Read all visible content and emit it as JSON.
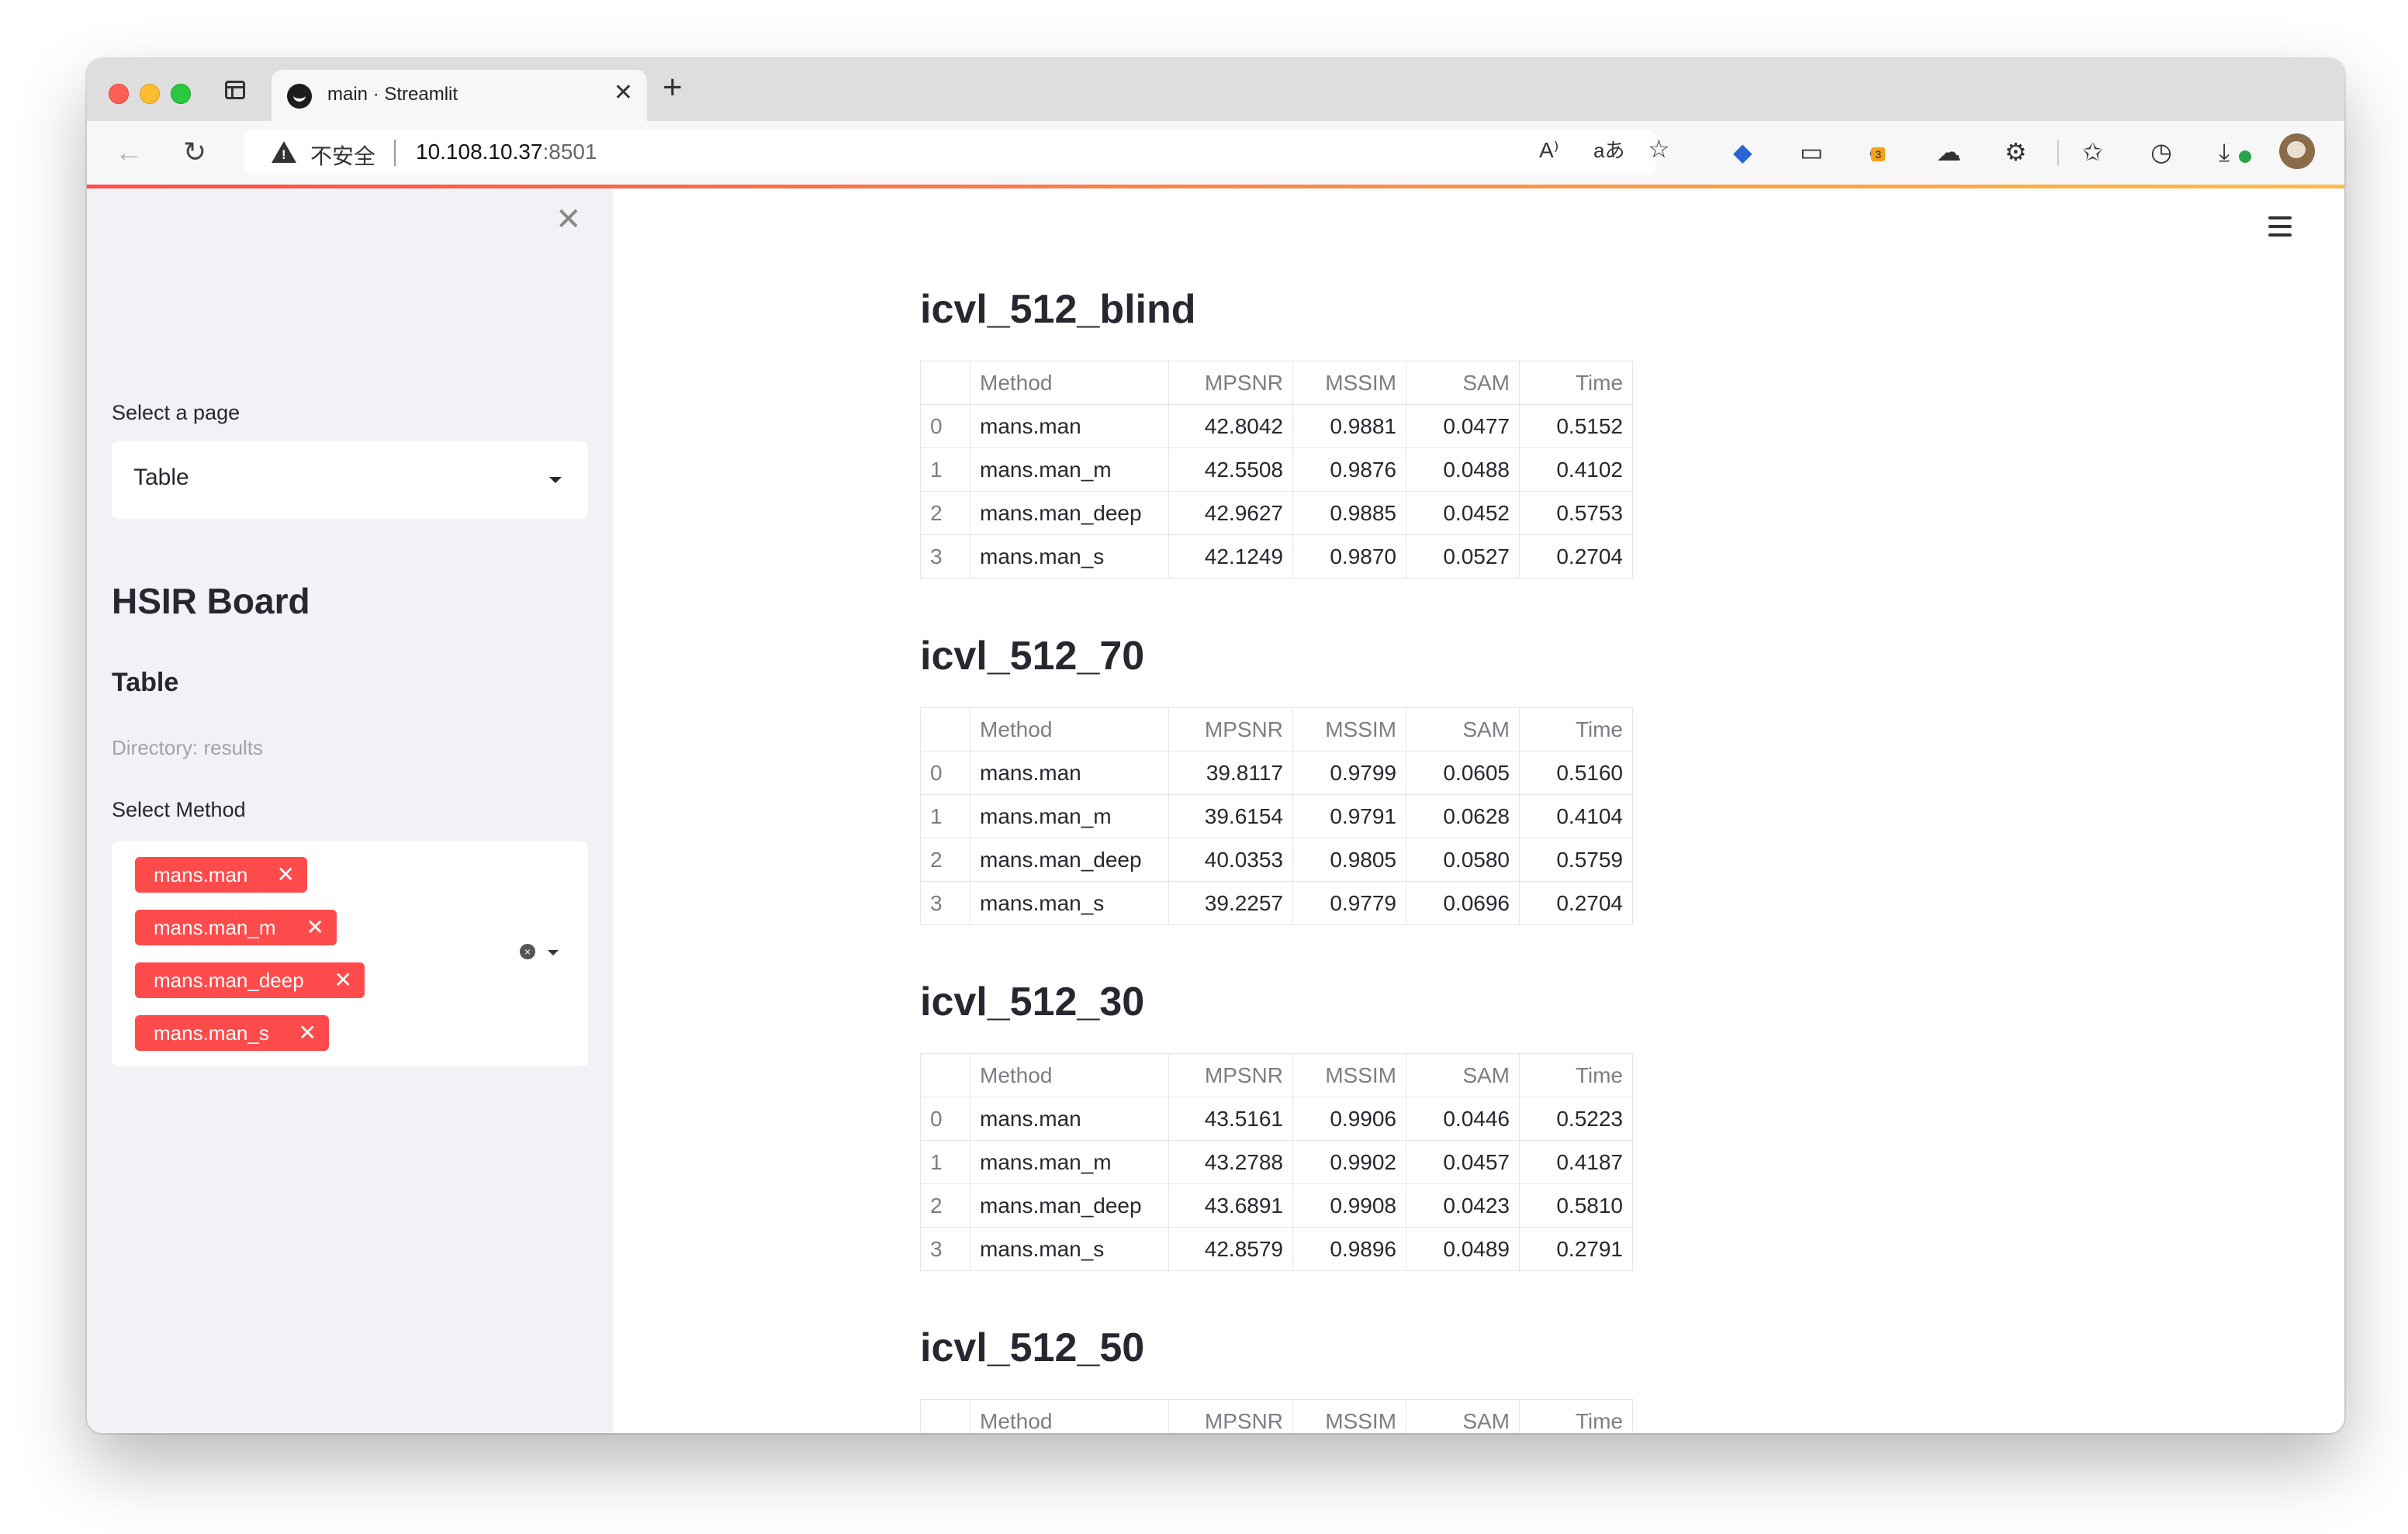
{
  "browser": {
    "tab_title": "main · Streamlit",
    "tab_close": "✕",
    "new_tab": "+",
    "insecure_label": "不安全",
    "url_host": "10.108.10.37",
    "url_port": ":8501",
    "extension_badge": "3",
    "icons": [
      "back-arrow-icon",
      "reload-icon",
      "read-aloud-icon",
      "translate-icon",
      "add-favorite-icon",
      "extension-icon",
      "reading-list-icon",
      "extension-icon",
      "cloud-icon",
      "extensions-icon",
      "favorites-icon",
      "history-icon",
      "downloads-icon",
      "profile-icon",
      "more-icon"
    ]
  },
  "sidebar": {
    "close": "✕",
    "select_page_label": "Select a page",
    "select_page_value": "Table",
    "title": "HSIR Board",
    "subtitle": "Table",
    "directory_caption": "Directory: results",
    "select_method_label": "Select Method",
    "chips": [
      {
        "label": "mans.man"
      },
      {
        "label": "mans.man_m"
      },
      {
        "label": "mans.man_deep"
      },
      {
        "label": "mans.man_s"
      }
    ],
    "chip_remove": "✕",
    "clear": "×"
  },
  "columns": [
    "",
    "Method",
    "MPSNR",
    "MSSIM",
    "SAM",
    "Time"
  ],
  "sections": [
    {
      "title": "icvl_512_blind",
      "rows": [
        [
          "0",
          "mans.man",
          "42.8042",
          "0.9881",
          "0.0477",
          "0.5152"
        ],
        [
          "1",
          "mans.man_m",
          "42.5508",
          "0.9876",
          "0.0488",
          "0.4102"
        ],
        [
          "2",
          "mans.man_deep",
          "42.9627",
          "0.9885",
          "0.0452",
          "0.5753"
        ],
        [
          "3",
          "mans.man_s",
          "42.1249",
          "0.9870",
          "0.0527",
          "0.2704"
        ]
      ]
    },
    {
      "title": "icvl_512_70",
      "rows": [
        [
          "0",
          "mans.man",
          "39.8117",
          "0.9799",
          "0.0605",
          "0.5160"
        ],
        [
          "1",
          "mans.man_m",
          "39.6154",
          "0.9791",
          "0.0628",
          "0.4104"
        ],
        [
          "2",
          "mans.man_deep",
          "40.0353",
          "0.9805",
          "0.0580",
          "0.5759"
        ],
        [
          "3",
          "mans.man_s",
          "39.2257",
          "0.9779",
          "0.0696",
          "0.2704"
        ]
      ]
    },
    {
      "title": "icvl_512_30",
      "rows": [
        [
          "0",
          "mans.man",
          "43.5161",
          "0.9906",
          "0.0446",
          "0.5223"
        ],
        [
          "1",
          "mans.man_m",
          "43.2788",
          "0.9902",
          "0.0457",
          "0.4187"
        ],
        [
          "2",
          "mans.man_deep",
          "43.6891",
          "0.9908",
          "0.0423",
          "0.5810"
        ],
        [
          "3",
          "mans.man_s",
          "42.8579",
          "0.9896",
          "0.0489",
          "0.2791"
        ]
      ]
    },
    {
      "title": "icvl_512_50",
      "rows": []
    }
  ],
  "colors": {
    "accent": "#ff4b4b",
    "sidebar_bg": "#f0f2f6",
    "text": "#262730"
  }
}
